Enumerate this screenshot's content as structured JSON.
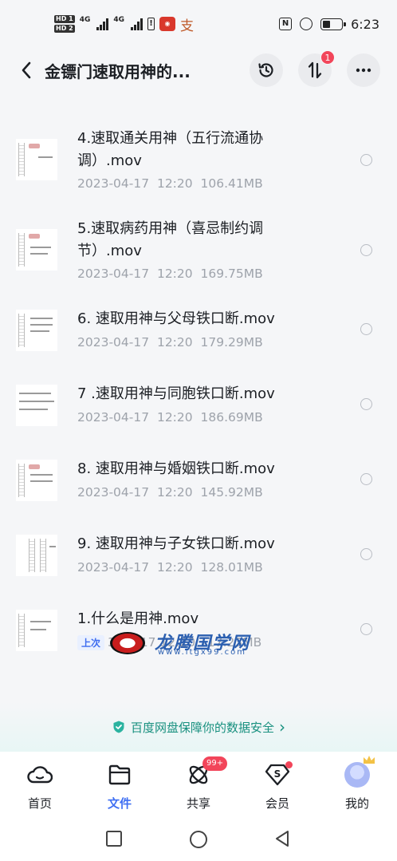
{
  "status_bar": {
    "time": "6:23",
    "hd1": "HD 1",
    "hd2": "HD 2",
    "net1": "4G",
    "net2": "4G",
    "app_icon2_char": "支",
    "battery_level": 0.4
  },
  "header": {
    "title": "金镖门速取用神的...",
    "transfer_badge": "1"
  },
  "files": [
    {
      "name": "4.速取通关用神（五行流通协调）.mov",
      "date": "2023-04-17",
      "time": "12:20",
      "size": "106.41MB"
    },
    {
      "name": "5.速取病药用神（喜忌制约调节）.mov",
      "date": "2023-04-17",
      "time": "12:20",
      "size": "169.75MB"
    },
    {
      "name": "6. 速取用神与父母铁口断.mov",
      "date": "2023-04-17",
      "time": "12:20",
      "size": "179.29MB"
    },
    {
      "name": "7 .速取用神与同胞铁口断.mov",
      "date": "2023-04-17",
      "time": "12:20",
      "size": "186.69MB"
    },
    {
      "name": "8. 速取用神与婚姻铁口断.mov",
      "date": "2023-04-17",
      "time": "12:20",
      "size": "145.92MB"
    },
    {
      "name": "9. 速取用神与子女铁口断.mov",
      "date": "2023-04-17",
      "time": "12:20",
      "size": "128.01MB"
    },
    {
      "name": "1.什么是用神.mov",
      "last_open_tag": "上次",
      "meta_visible": "3-04-17  12:20  117.23MB"
    }
  ],
  "watermark": {
    "text": "龙腾国学网",
    "url": "www.ltgx99.com"
  },
  "safety_banner": {
    "text": "百度网盘保障你的数据安全",
    "arrow": "›"
  },
  "tabs": [
    {
      "label": "首页",
      "icon": "home-cloud-icon"
    },
    {
      "label": "文件",
      "icon": "folder-icon",
      "active": true
    },
    {
      "label": "共享",
      "icon": "share-atom-icon",
      "badge": "99+"
    },
    {
      "label": "会员",
      "icon": "vip-diamond-icon",
      "dot": true
    },
    {
      "label": "我的",
      "icon": "avatar-icon"
    }
  ],
  "colors": {
    "accent": "#3f6ff3",
    "badge": "#f2455a",
    "safety": "#18907f",
    "meta": "#9ea3ab"
  }
}
